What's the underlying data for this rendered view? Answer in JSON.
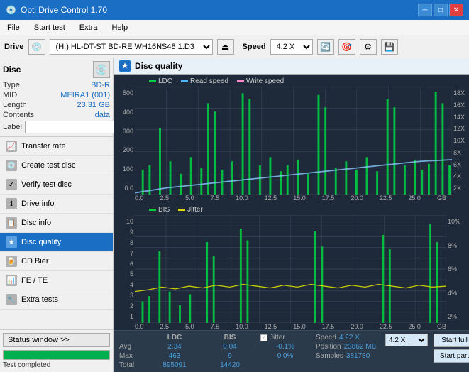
{
  "app": {
    "title": "Opti Drive Control 1.70",
    "icon": "💿"
  },
  "titlebar": {
    "minimize": "─",
    "maximize": "□",
    "close": "✕"
  },
  "menu": {
    "items": [
      "File",
      "Start test",
      "Extra",
      "Help"
    ]
  },
  "toolbar": {
    "drive_label": "Drive",
    "drive_value": "(H:) HL-DT-ST BD-RE  WH16NS48 1.D3",
    "speed_label": "Speed",
    "speed_value": "4.2 X"
  },
  "disc": {
    "section_label": "Disc",
    "type_label": "Type",
    "type_value": "BD-R",
    "mid_label": "MID",
    "mid_value": "MEIRA1 (001)",
    "length_label": "Length",
    "length_value": "23.31 GB",
    "contents_label": "Contents",
    "contents_value": "data",
    "label_label": "Label",
    "label_value": ""
  },
  "nav": {
    "items": [
      {
        "id": "transfer-rate",
        "label": "Transfer rate",
        "icon": "📈"
      },
      {
        "id": "create-test-disc",
        "label": "Create test disc",
        "icon": "💿"
      },
      {
        "id": "verify-test-disc",
        "label": "Verify test disc",
        "icon": "✓"
      },
      {
        "id": "drive-info",
        "label": "Drive info",
        "icon": "ℹ"
      },
      {
        "id": "disc-info",
        "label": "Disc info",
        "icon": "📋"
      },
      {
        "id": "disc-quality",
        "label": "Disc quality",
        "icon": "★",
        "active": true
      },
      {
        "id": "cd-bier",
        "label": "CD Bier",
        "icon": "🍺"
      },
      {
        "id": "fe-te",
        "label": "FE / TE",
        "icon": "📊"
      },
      {
        "id": "extra-tests",
        "label": "Extra tests",
        "icon": "🔧"
      }
    ]
  },
  "status": {
    "window_btn": "Status window >>",
    "progress": 100,
    "text": "Test completed"
  },
  "quality": {
    "title": "Disc quality",
    "legend": {
      "ldc": "LDC",
      "read_speed": "Read speed",
      "write_speed": "Write speed",
      "bis": "BIS",
      "jitter": "Jitter"
    }
  },
  "stats": {
    "ldc_header": "LDC",
    "bis_header": "BIS",
    "jitter_header": "Jitter",
    "speed_header": "Speed",
    "position_header": "Position",
    "samples_header": "Samples",
    "avg_label": "Avg",
    "max_label": "Max",
    "total_label": "Total",
    "ldc_avg": "2.34",
    "ldc_max": "463",
    "ldc_total": "895091",
    "bis_avg": "0.04",
    "bis_max": "9",
    "bis_total": "14420",
    "jitter_avg": "-0.1%",
    "jitter_max": "0.0%",
    "jitter_total": "",
    "speed_val": "4.22 X",
    "position_val": "23862 MB",
    "samples_val": "381780",
    "start_full": "Start full",
    "start_part": "Start part"
  },
  "colors": {
    "ldc": "#00cc44",
    "read_speed": "#4af",
    "write_speed": "#f4a",
    "bis": "#00cc44",
    "jitter": "#dddd00",
    "bg": "#1e2a3a",
    "grid": "#3a4a5a",
    "accent": "#1a6fc4"
  }
}
